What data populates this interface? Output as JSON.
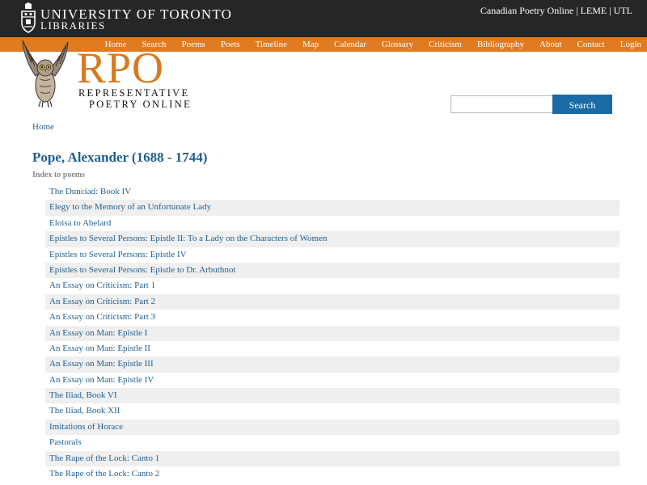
{
  "header": {
    "university_line1": "UNIVERSITY  OF  TORONTO",
    "university_line2": "LIBRARIES",
    "top_links": [
      "Canadian Poetry Online",
      "LEME",
      "UTL"
    ],
    "top_link_separator": "|"
  },
  "nav": {
    "items": [
      "Home",
      "Search",
      "Poems",
      "Poets",
      "Timeline",
      "Map",
      "Calendar",
      "Glossary",
      "Criticism",
      "Bibliography",
      "About",
      "Contact",
      "Login"
    ]
  },
  "logo": {
    "big": "RPO",
    "sub1": "REPRESENTATIVE",
    "sub2": "POETRY ONLINE"
  },
  "search": {
    "value": "",
    "placeholder": "",
    "button_label": "Search"
  },
  "breadcrumb": "Home",
  "page_title": "Pope, Alexander (1688 - 1744)",
  "index_label": "Index to poems",
  "poems": [
    "The Dunciad: Book IV",
    "Elegy to the Memory of an Unfortunate Lady",
    "Eloisa to Abelard",
    "Epistles to Several Persons: Epistle II: To a Lady on the Characters of Women",
    "Epistles to Several Persons: Epistle IV",
    "Epistles to Several Persons: Epistle to Dr. Arbuthnot",
    "An Essay on Criticism: Part 1",
    "An Essay on Criticism: Part 2",
    "An Essay on Criticism: Part 3",
    "An Essay on Man: Epistle I",
    "An Essay on Man: Epistle II",
    "An Essay on Man: Epistle III",
    "An Essay on Man: Epistle IV",
    "The Iliad, Book VI",
    "The Iliad, Book XII",
    "Imitations of Horace",
    "Pastorals",
    "The Rape of the Lock: Canto 1",
    "The Rape of the Lock: Canto 2"
  ],
  "colors": {
    "topbar": "#262626",
    "navbar": "#e07b22",
    "logo_orange": "#d77a1e",
    "link_blue": "#1f5f8f",
    "button_blue": "#1a6aa5",
    "stripe": "#efefef"
  },
  "icons": {
    "crest": "university-crest-icon",
    "owl": "owl-logo-icon"
  }
}
